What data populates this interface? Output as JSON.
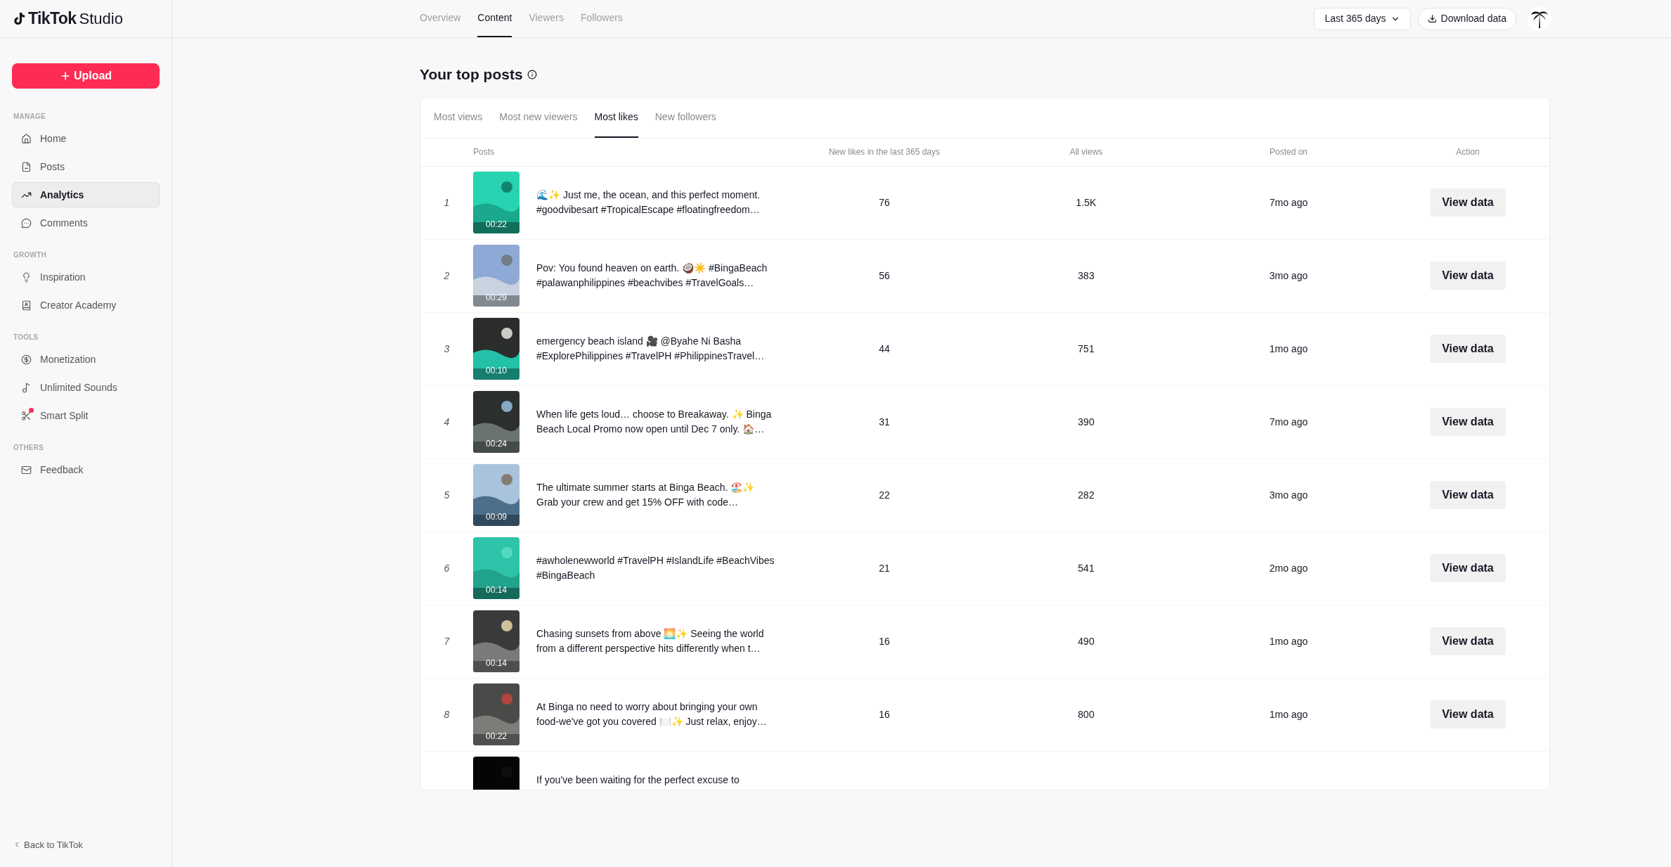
{
  "logo": {
    "brand": "TikTok",
    "product": "Studio"
  },
  "upload_button": "Upload",
  "sidebar": {
    "sections": [
      {
        "title": "MANAGE",
        "items": [
          {
            "label": "Home",
            "selected": false,
            "badge": false
          },
          {
            "label": "Posts",
            "selected": false,
            "badge": false
          },
          {
            "label": "Analytics",
            "selected": true,
            "badge": false
          },
          {
            "label": "Comments",
            "selected": false,
            "badge": false
          }
        ]
      },
      {
        "title": "GROWTH",
        "items": [
          {
            "label": "Inspiration",
            "selected": false,
            "badge": false
          },
          {
            "label": "Creator Academy",
            "selected": false,
            "badge": false
          }
        ]
      },
      {
        "title": "TOOLS",
        "items": [
          {
            "label": "Monetization",
            "selected": false,
            "badge": false
          },
          {
            "label": "Unlimited Sounds",
            "selected": false,
            "badge": false
          },
          {
            "label": "Smart Split",
            "selected": false,
            "badge": true
          }
        ]
      },
      {
        "title": "OTHERS",
        "items": [
          {
            "label": "Feedback",
            "selected": false,
            "badge": false
          }
        ]
      }
    ],
    "back_link": "Back to TikTok"
  },
  "top_tabs": [
    {
      "label": "Overview",
      "selected": false
    },
    {
      "label": "Content",
      "selected": true
    },
    {
      "label": "Viewers",
      "selected": false
    },
    {
      "label": "Followers",
      "selected": false
    }
  ],
  "date_range": "Last 365 days",
  "download_button": "Download data",
  "section_title": "Your top posts",
  "post_tabs": [
    {
      "label": "Most views",
      "selected": false
    },
    {
      "label": "Most new viewers",
      "selected": false
    },
    {
      "label": "Most likes",
      "selected": true
    },
    {
      "label": "New followers",
      "selected": false
    }
  ],
  "table": {
    "columns": [
      "Posts",
      "New likes in the last 365 days",
      "All views",
      "Posted on",
      "Action"
    ],
    "rows": [
      {
        "rank": "1",
        "duration": "00:22",
        "caption": "🌊✨ Just me, the ocean, and this perfect moment. #goodvibesart #TropicalEscape #floatingfreedom…",
        "likes": "76",
        "views": "1.5K",
        "posted": "7mo ago",
        "action": "View data"
      },
      {
        "rank": "2",
        "duration": "00:29",
        "caption": "Pov: You found heaven on earth. 🥥☀️ #BingaBeach #palawanphilippines #beachvibes #TravelGoals…",
        "likes": "56",
        "views": "383",
        "posted": "3mo ago",
        "action": "View data"
      },
      {
        "rank": "3",
        "duration": "00:10",
        "caption": "emergency beach island 🎥 @Byahe Ni Basha #ExplorePhilippines #TravelPH #PhilippinesTravel…",
        "likes": "44",
        "views": "751",
        "posted": "1mo ago",
        "action": "View data"
      },
      {
        "rank": "4",
        "duration": "00:24",
        "caption": "When life gets loud… choose to Breakaway. ✨ Binga Beach Local Promo now open until Dec 7 only. 🏠…",
        "likes": "31",
        "views": "390",
        "posted": "7mo ago",
        "action": "View data"
      },
      {
        "rank": "5",
        "duration": "00:09",
        "caption": "The ultimate summer starts at Binga Beach. 🏖️✨ Grab your crew and get 15% OFF with code…",
        "likes": "22",
        "views": "282",
        "posted": "3mo ago",
        "action": "View data"
      },
      {
        "rank": "6",
        "duration": "00:14",
        "caption": "#awholenewworld #TravelPH #IslandLife #BeachVibes #BingaBeach",
        "likes": "21",
        "views": "541",
        "posted": "2mo ago",
        "action": "View data"
      },
      {
        "rank": "7",
        "duration": "00:14",
        "caption": "Chasing sunsets from above 🌅✨ Seeing the world from a different perspective hits differently when t…",
        "likes": "16",
        "views": "490",
        "posted": "1mo ago",
        "action": "View data"
      },
      {
        "rank": "8",
        "duration": "00:22",
        "caption": "At Binga no need to worry about bringing your own food-we've got you covered 🍽️✨ Just relax, enjoy…",
        "likes": "16",
        "views": "800",
        "posted": "1mo ago",
        "action": "View data"
      },
      {
        "caption": "If you’ve been waiting for the perfect excuse to"
      }
    ]
  }
}
